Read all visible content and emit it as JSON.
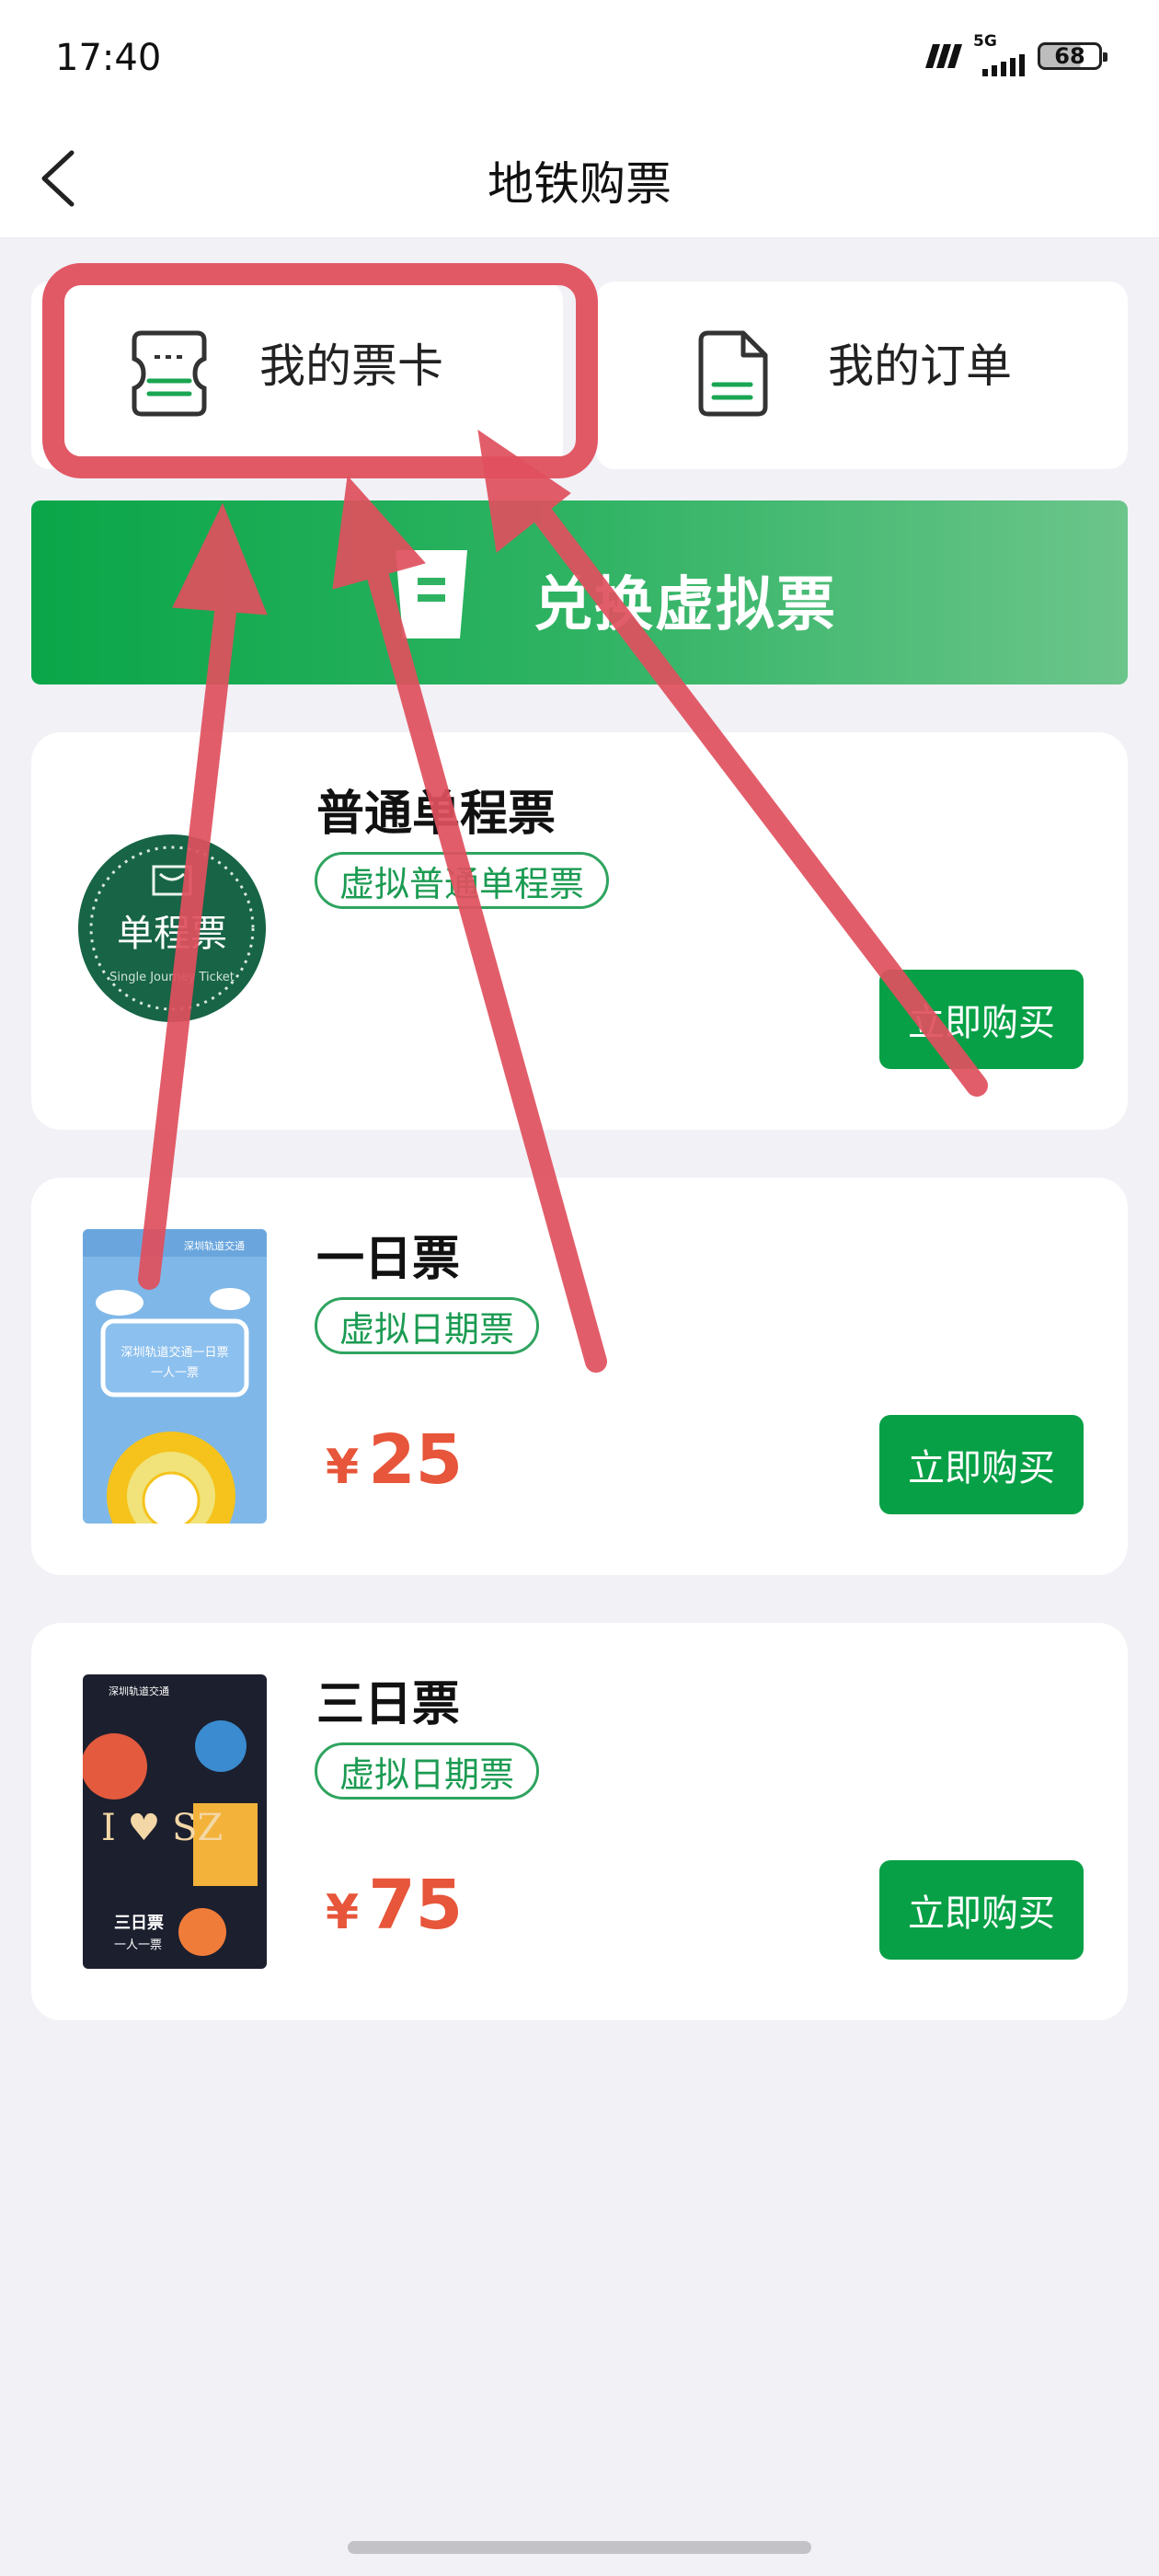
{
  "status_bar": {
    "time": "17:40",
    "network": "5G",
    "battery": "68"
  },
  "navbar": {
    "title": "地铁购票"
  },
  "tabs": [
    {
      "label": "我的票卡",
      "icon": "ticket-card-icon"
    },
    {
      "label": "我的订单",
      "icon": "document-icon"
    }
  ],
  "redeem": {
    "label": "兑换虚拟票",
    "icon": "cup-icon"
  },
  "tickets": [
    {
      "name": "普通单程票",
      "tag": "虚拟普通单程票",
      "yen": "",
      "price": "",
      "button": "立即购买",
      "thumb_text_main": "单程票",
      "thumb_text_sub": "Single Journey Ticket"
    },
    {
      "name": "一日票",
      "tag": "虚拟日期票",
      "yen": "¥",
      "price": "25",
      "button": "立即购买",
      "thumb_header": "深圳轨道交通",
      "thumb_line1": "深圳轨道交通一日票",
      "thumb_line2": "一人一票"
    },
    {
      "name": "三日票",
      "tag": "虚拟日期票",
      "yen": "¥",
      "price": "75",
      "button": "立即购买",
      "thumb_header": "深圳轨道交通",
      "thumb_brand": "I ♥ SZ",
      "thumb_line1": "三日票",
      "thumb_line2": "一人一票"
    }
  ],
  "colors": {
    "accent_green": "#07a046",
    "price_red": "#e7553a",
    "annotation_red": "#e0505e"
  }
}
